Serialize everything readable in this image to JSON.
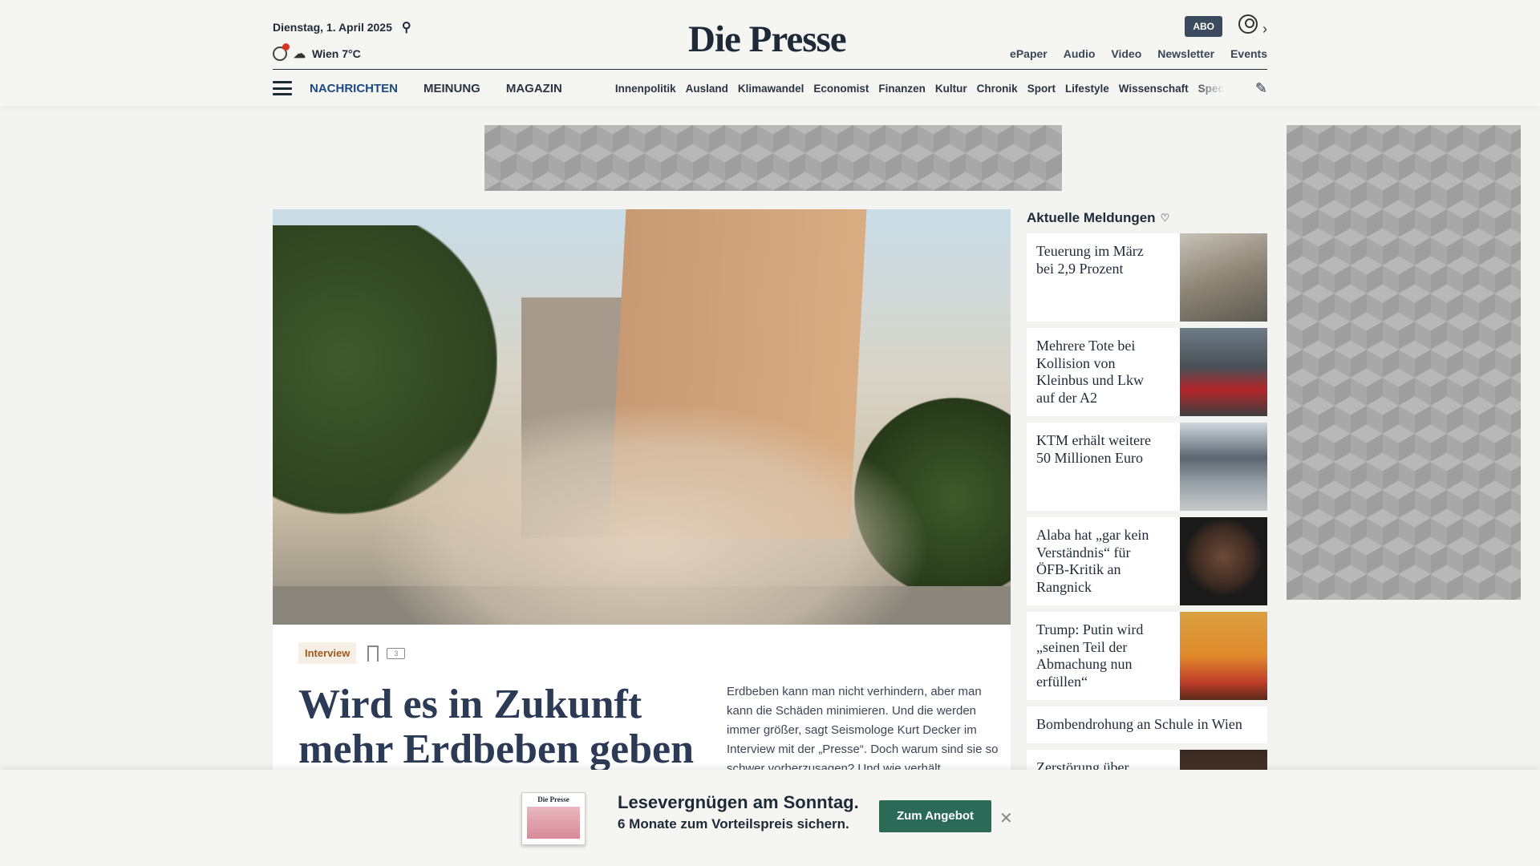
{
  "header": {
    "date": "Dienstag, 1. April 2025",
    "weather": "Wien 7°C",
    "logo": "Die Presse",
    "abo": "ABO",
    "service_links": [
      "ePaper",
      "Audio",
      "Video",
      "Newsletter",
      "Events"
    ]
  },
  "nav": {
    "main": [
      "NACHRICHTEN",
      "MEINUNG",
      "MAGAZIN"
    ],
    "sub": [
      "Innenpolitik",
      "Ausland",
      "Klimawandel",
      "Economist",
      "Finanzen",
      "Kultur",
      "Chronik",
      "Sport",
      "Lifestyle",
      "Wissenschaft",
      "Spectrum"
    ]
  },
  "hero": {
    "tag": "Interview",
    "comment_count": "3",
    "headline": "Wird es in Zukunft mehr Erdbeben geben",
    "teaser": "Erdbeben kann man nicht verhindern, aber man kann die Schäden minimieren. Und die werden immer größer, sagt Seismologe Kurt Decker im Interview mit der „Presse“. Doch warum sind sie so schwer vorherzusagen? Und wie verhält"
  },
  "sidebar": {
    "title": "Aktuelle Meldungen",
    "items": [
      {
        "title": "Teuerung im März bei 2,9 Prozent"
      },
      {
        "title": "Mehrere Tote bei Kollision von Kleinbus und Lkw auf der A2"
      },
      {
        "title": "KTM erhält weitere 50 Millionen Euro"
      },
      {
        "title": "Alaba hat „gar kein Verständnis“ für ÖFB-Kritik an Rangnick"
      },
      {
        "title": "Trump: Putin wird „seinen Teil der Abmachung nun erfüllen“"
      },
      {
        "title": "Bombendrohung an Schule in Wien"
      },
      {
        "title": "Zerstörung über"
      }
    ]
  },
  "promo": {
    "mini_logo": "Die Presse",
    "headline": "Lesevergnügen am Sonntag.",
    "sub": "6 Monate zum Vorteilspreis sichern.",
    "button": "Zum Angebot"
  }
}
